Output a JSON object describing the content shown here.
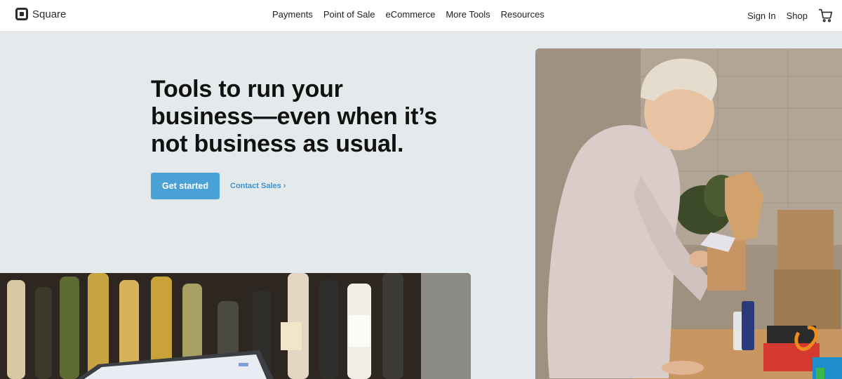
{
  "header": {
    "logo_text": "Square",
    "nav": [
      "Payments",
      "Point of Sale",
      "eCommerce",
      "More Tools",
      "Resources"
    ],
    "sign_in": "Sign In",
    "shop": "Shop"
  },
  "hero": {
    "headline_line1": "Tools to run your",
    "headline_line2": "business—even when it’s",
    "headline_line3": "not business as usual.",
    "cta_label": "Get started",
    "contact_label": "Contact Sales ›"
  },
  "colors": {
    "background": "#e4eaec",
    "cta": "#4aa1d6",
    "link": "#3b92cf",
    "header_bg": "#ffffff"
  },
  "icons": [
    "square-logo-icon",
    "cart-icon"
  ]
}
